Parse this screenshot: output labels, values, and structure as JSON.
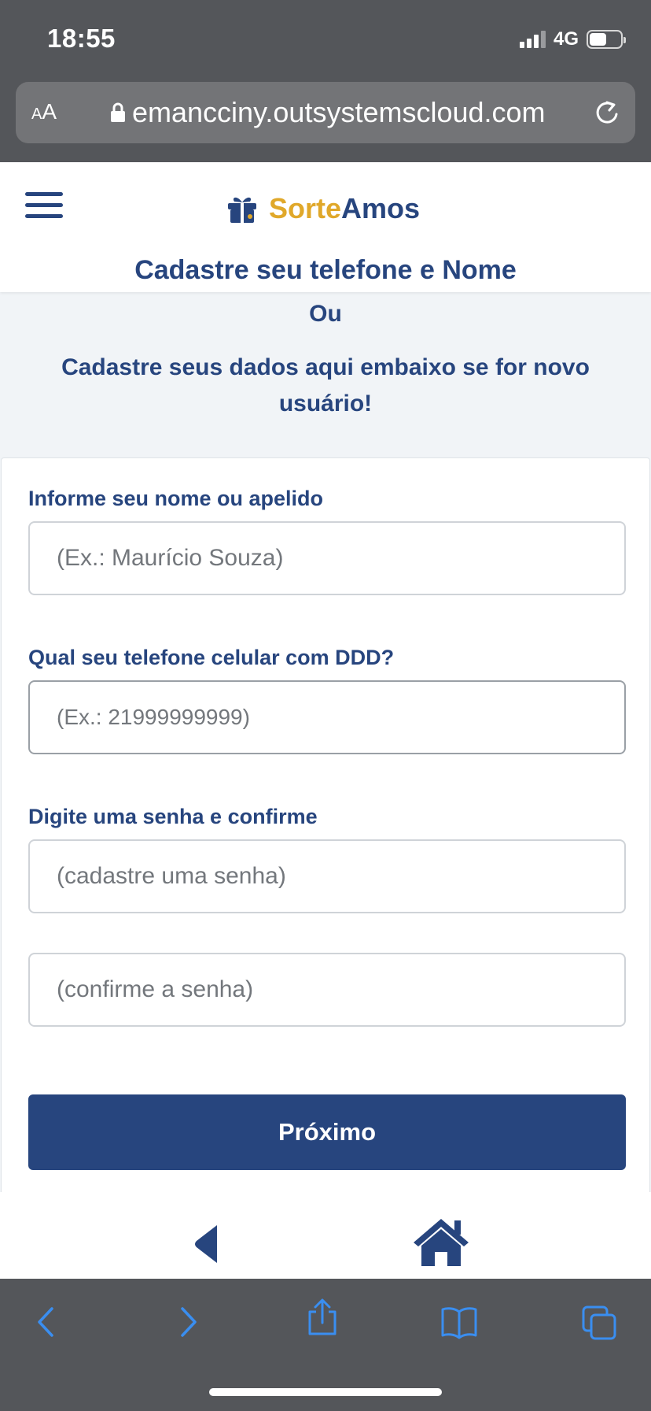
{
  "status_bar": {
    "time": "18:55",
    "network": "4G",
    "battery_level": 0.55
  },
  "browser": {
    "text_size_label": "A",
    "text_size_label_small": "A",
    "url": "emancciny.outsystemscloud.com"
  },
  "header": {
    "logo_part1": "Sorte",
    "logo_part2": "Amos",
    "title": "Cadastre seu telefone e Nome"
  },
  "intro": {
    "or_text": "Ou",
    "subtitle": "Cadastre seus dados aqui embaixo se for novo usuário!"
  },
  "form": {
    "name_label": "Informe seu nome ou apelido",
    "name_placeholder": "(Ex.: Maurício Souza)",
    "phone_label": "Qual seu telefone celular com DDD?",
    "phone_placeholder": "(Ex.: 21999999999)",
    "password_label": "Digite uma senha e confirme",
    "password_placeholder": "(cadastre uma senha)",
    "confirm_placeholder": "(confirme a senha)",
    "next_label": "Próximo"
  },
  "colors": {
    "primary": "#27457e",
    "accent": "#e0a82a",
    "safari_blue": "#3a8ef0"
  },
  "icons": [
    "menu-icon",
    "gift-icon",
    "back-icon",
    "home-icon",
    "lock-icon",
    "reload-icon",
    "share-icon",
    "bookmarks-icon",
    "tabs-icon"
  ]
}
